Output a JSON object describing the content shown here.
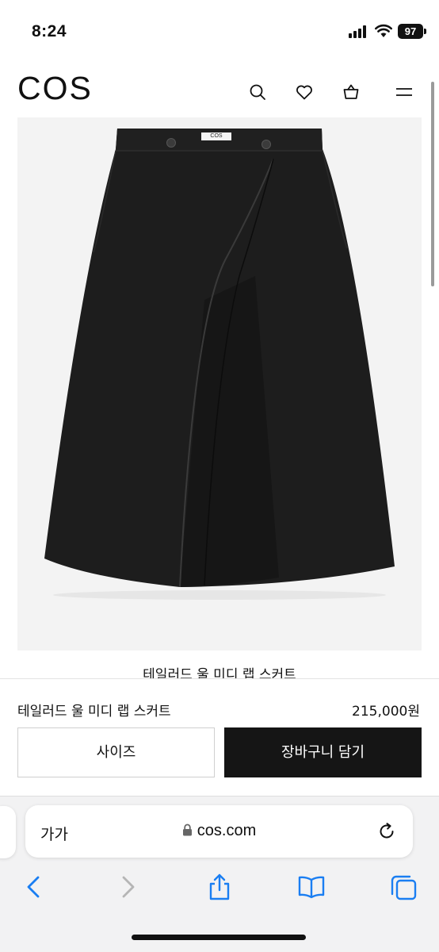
{
  "status_bar": {
    "time": "8:24",
    "battery": "97"
  },
  "header": {
    "logo": "COS",
    "icons": [
      "search-icon",
      "heart-icon",
      "bag-icon",
      "menu-icon"
    ]
  },
  "product": {
    "title": "테일러드 울 미디 랩 스커트",
    "waistband_tag": "COS",
    "image_bg": "#f3f3f3",
    "garment_color": "#1c1c1c"
  },
  "buy_bar": {
    "name": "테일러드 울 미디 랩 스커트",
    "price": "215,000원",
    "size_button": "사이즈",
    "cart_button": "장바구니 담기"
  },
  "browser": {
    "text_size_label": "가가",
    "url": "cos.com",
    "accent": "#1a7ef2"
  }
}
